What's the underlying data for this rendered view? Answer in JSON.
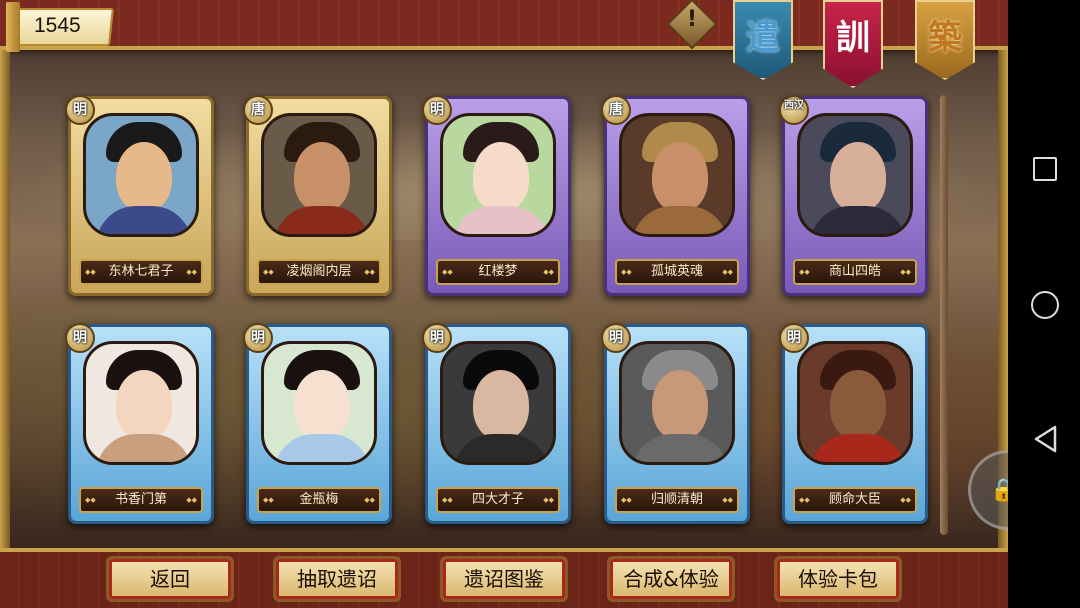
{
  "currency": {
    "value": "1545"
  },
  "top_icons": {
    "warning_glyph": "!",
    "banners": [
      {
        "label": "遣",
        "color": "#1e5a7a"
      },
      {
        "label": "訓",
        "color": "#8a1030"
      },
      {
        "label": "築",
        "color": "#9a6a1e"
      }
    ]
  },
  "cards": [
    {
      "dynasty": "明",
      "name": "东林七君子",
      "frame": "gold"
    },
    {
      "dynasty": "唐",
      "name": "凌烟阁内层",
      "frame": "gold"
    },
    {
      "dynasty": "明",
      "name": "红楼梦",
      "frame": "purple"
    },
    {
      "dynasty": "唐",
      "name": "孤城英魂",
      "frame": "purple"
    },
    {
      "dynasty": "西汉",
      "name": "商山四皓",
      "frame": "purple"
    },
    {
      "dynasty": "明",
      "name": "书香门第",
      "frame": "blue"
    },
    {
      "dynasty": "明",
      "name": "金瓶梅",
      "frame": "blue"
    },
    {
      "dynasty": "明",
      "name": "四大才子",
      "frame": "blue"
    },
    {
      "dynasty": "明",
      "name": "归顺清朝",
      "frame": "blue"
    },
    {
      "dynasty": "明",
      "name": "顾命大臣",
      "frame": "blue"
    }
  ],
  "bottom_buttons": [
    "返回",
    "抽取遗诏",
    "遗诏图鉴",
    "合成&体验",
    "体验卡包"
  ],
  "colors": {
    "gold": "#c9a24a",
    "bar_red": "#7a2a1e"
  }
}
